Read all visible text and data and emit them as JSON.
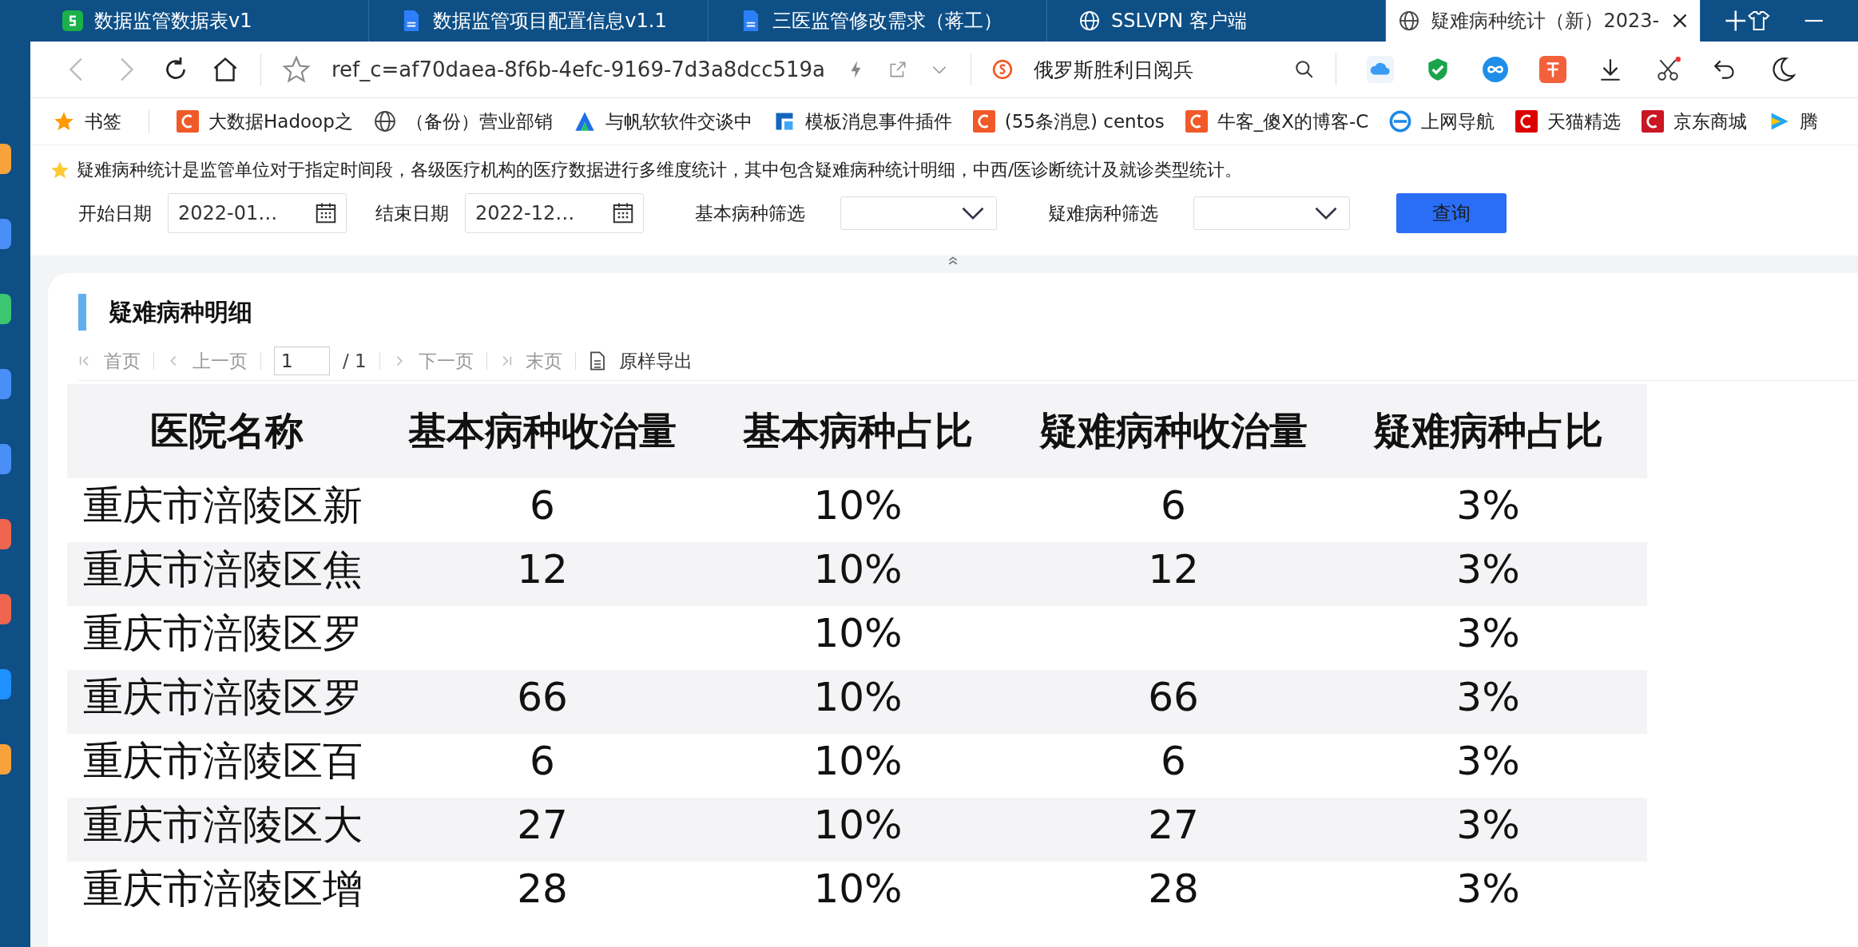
{
  "browser": {
    "tabs": [
      {
        "title": "数据监管数据表v1",
        "kind": "sheet",
        "selected": false
      },
      {
        "title": "数据监管项目配置信息v1.1",
        "kind": "doc",
        "selected": false
      },
      {
        "title": "三医监管修改需求（蒋工）",
        "kind": "doc",
        "selected": false
      },
      {
        "title": "SSLVPN 客户端",
        "kind": "web",
        "selected": false
      },
      {
        "title": "疑难病种统计（新）2023-",
        "kind": "web",
        "selected": true
      }
    ],
    "address": "ref_c=af70daea-8f6b-4efc-9169-7d3a8dcc519a",
    "search_text": "俄罗斯胜利日阅兵",
    "bookmarks": [
      {
        "label": "书签",
        "kind": "folder"
      },
      {
        "label": "大数据Hadoop之",
        "kind": "blog"
      },
      {
        "label": "（备份）营业部销",
        "kind": "web"
      },
      {
        "label": "与帆软软件交谈中",
        "kind": "chat"
      },
      {
        "label": "模板消息事件插件",
        "kind": "docs"
      },
      {
        "label": "(55条消息) centos",
        "kind": "blog"
      },
      {
        "label": "牛客_傻X的博客-C",
        "kind": "blog"
      },
      {
        "label": "上网导航",
        "kind": "nav"
      },
      {
        "label": "天猫精选",
        "kind": "shop"
      },
      {
        "label": "京东商城",
        "kind": "store"
      },
      {
        "label": "腾",
        "kind": "video"
      }
    ]
  },
  "notice": "疑难病种统计是监管单位对于指定时间段，各级医疗机构的医疗数据进行多维度统计，其中包含疑难病种统计明细，中西/医诊断统计及就诊类型统计。",
  "filters": {
    "start_label": "开始日期",
    "start_value": "2022-01…",
    "end_label": "结束日期",
    "end_value": "2022-12…",
    "basic_label": "基本病种筛选",
    "difficult_label": "疑难病种筛选",
    "query_button": "查询"
  },
  "section_title": "疑难病种明细",
  "pager": {
    "first": "首页",
    "prev": "上一页",
    "page": "1",
    "total": "/ 1",
    "next": "下一页",
    "last": "末页",
    "export": "原样导出"
  },
  "table": {
    "columns": [
      "医院名称",
      "基本病种收治量",
      "基本病种占比",
      "疑难病种收治量",
      "疑难病种占比"
    ],
    "rows": [
      [
        "重庆市涪陵区新",
        "6",
        "10%",
        "6",
        "3%"
      ],
      [
        "重庆市涪陵区焦",
        "12",
        "10%",
        "12",
        "3%"
      ],
      [
        "重庆市涪陵区罗",
        "",
        "10%",
        "",
        "3%"
      ],
      [
        "重庆市涪陵区罗",
        "66",
        "10%",
        "66",
        "3%"
      ],
      [
        "重庆市涪陵区百",
        "6",
        "10%",
        "6",
        "3%"
      ],
      [
        "重庆市涪陵区大",
        "27",
        "10%",
        "27",
        "3%"
      ],
      [
        "重庆市涪陵区增",
        "28",
        "10%",
        "28",
        "3%"
      ]
    ]
  }
}
